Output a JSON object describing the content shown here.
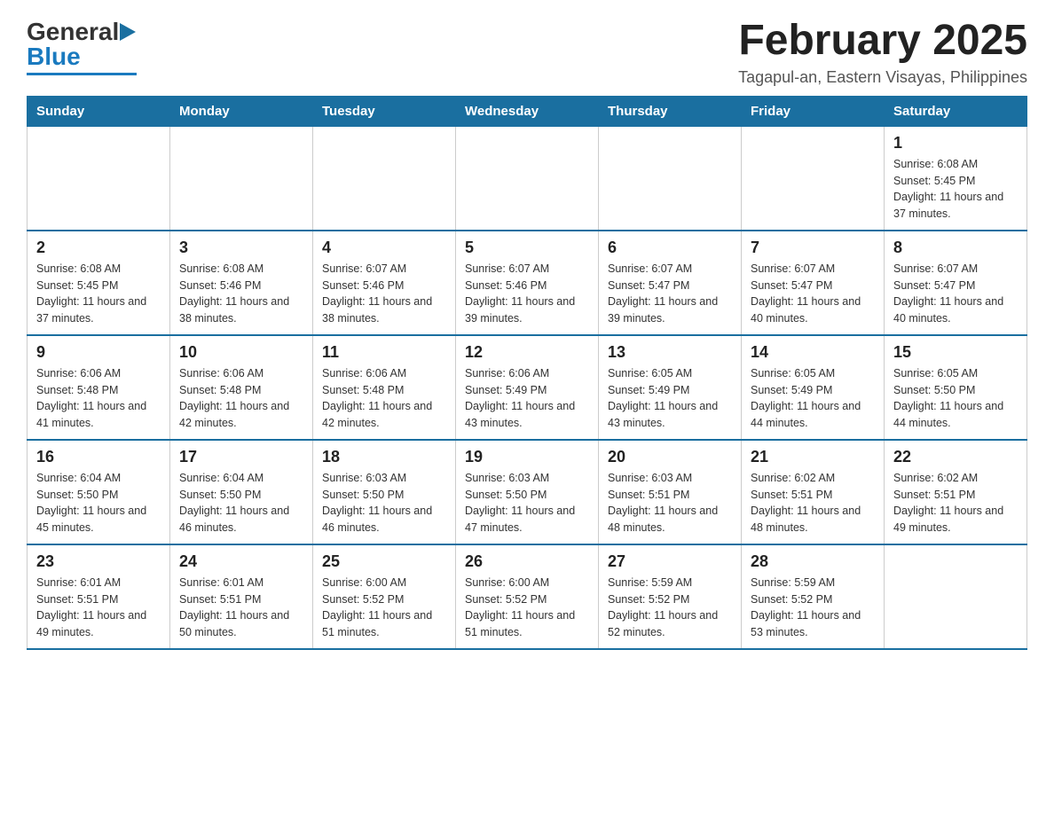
{
  "header": {
    "logo_general": "General",
    "logo_blue": "Blue",
    "month_title": "February 2025",
    "location": "Tagapul-an, Eastern Visayas, Philippines"
  },
  "days_of_week": [
    "Sunday",
    "Monday",
    "Tuesday",
    "Wednesday",
    "Thursday",
    "Friday",
    "Saturday"
  ],
  "weeks": [
    [
      {
        "day": "",
        "info": ""
      },
      {
        "day": "",
        "info": ""
      },
      {
        "day": "",
        "info": ""
      },
      {
        "day": "",
        "info": ""
      },
      {
        "day": "",
        "info": ""
      },
      {
        "day": "",
        "info": ""
      },
      {
        "day": "1",
        "info": "Sunrise: 6:08 AM\nSunset: 5:45 PM\nDaylight: 11 hours and 37 minutes."
      }
    ],
    [
      {
        "day": "2",
        "info": "Sunrise: 6:08 AM\nSunset: 5:45 PM\nDaylight: 11 hours and 37 minutes."
      },
      {
        "day": "3",
        "info": "Sunrise: 6:08 AM\nSunset: 5:46 PM\nDaylight: 11 hours and 38 minutes."
      },
      {
        "day": "4",
        "info": "Sunrise: 6:07 AM\nSunset: 5:46 PM\nDaylight: 11 hours and 38 minutes."
      },
      {
        "day": "5",
        "info": "Sunrise: 6:07 AM\nSunset: 5:46 PM\nDaylight: 11 hours and 39 minutes."
      },
      {
        "day": "6",
        "info": "Sunrise: 6:07 AM\nSunset: 5:47 PM\nDaylight: 11 hours and 39 minutes."
      },
      {
        "day": "7",
        "info": "Sunrise: 6:07 AM\nSunset: 5:47 PM\nDaylight: 11 hours and 40 minutes."
      },
      {
        "day": "8",
        "info": "Sunrise: 6:07 AM\nSunset: 5:47 PM\nDaylight: 11 hours and 40 minutes."
      }
    ],
    [
      {
        "day": "9",
        "info": "Sunrise: 6:06 AM\nSunset: 5:48 PM\nDaylight: 11 hours and 41 minutes."
      },
      {
        "day": "10",
        "info": "Sunrise: 6:06 AM\nSunset: 5:48 PM\nDaylight: 11 hours and 42 minutes."
      },
      {
        "day": "11",
        "info": "Sunrise: 6:06 AM\nSunset: 5:48 PM\nDaylight: 11 hours and 42 minutes."
      },
      {
        "day": "12",
        "info": "Sunrise: 6:06 AM\nSunset: 5:49 PM\nDaylight: 11 hours and 43 minutes."
      },
      {
        "day": "13",
        "info": "Sunrise: 6:05 AM\nSunset: 5:49 PM\nDaylight: 11 hours and 43 minutes."
      },
      {
        "day": "14",
        "info": "Sunrise: 6:05 AM\nSunset: 5:49 PM\nDaylight: 11 hours and 44 minutes."
      },
      {
        "day": "15",
        "info": "Sunrise: 6:05 AM\nSunset: 5:50 PM\nDaylight: 11 hours and 44 minutes."
      }
    ],
    [
      {
        "day": "16",
        "info": "Sunrise: 6:04 AM\nSunset: 5:50 PM\nDaylight: 11 hours and 45 minutes."
      },
      {
        "day": "17",
        "info": "Sunrise: 6:04 AM\nSunset: 5:50 PM\nDaylight: 11 hours and 46 minutes."
      },
      {
        "day": "18",
        "info": "Sunrise: 6:03 AM\nSunset: 5:50 PM\nDaylight: 11 hours and 46 minutes."
      },
      {
        "day": "19",
        "info": "Sunrise: 6:03 AM\nSunset: 5:50 PM\nDaylight: 11 hours and 47 minutes."
      },
      {
        "day": "20",
        "info": "Sunrise: 6:03 AM\nSunset: 5:51 PM\nDaylight: 11 hours and 48 minutes."
      },
      {
        "day": "21",
        "info": "Sunrise: 6:02 AM\nSunset: 5:51 PM\nDaylight: 11 hours and 48 minutes."
      },
      {
        "day": "22",
        "info": "Sunrise: 6:02 AM\nSunset: 5:51 PM\nDaylight: 11 hours and 49 minutes."
      }
    ],
    [
      {
        "day": "23",
        "info": "Sunrise: 6:01 AM\nSunset: 5:51 PM\nDaylight: 11 hours and 49 minutes."
      },
      {
        "day": "24",
        "info": "Sunrise: 6:01 AM\nSunset: 5:51 PM\nDaylight: 11 hours and 50 minutes."
      },
      {
        "day": "25",
        "info": "Sunrise: 6:00 AM\nSunset: 5:52 PM\nDaylight: 11 hours and 51 minutes."
      },
      {
        "day": "26",
        "info": "Sunrise: 6:00 AM\nSunset: 5:52 PM\nDaylight: 11 hours and 51 minutes."
      },
      {
        "day": "27",
        "info": "Sunrise: 5:59 AM\nSunset: 5:52 PM\nDaylight: 11 hours and 52 minutes."
      },
      {
        "day": "28",
        "info": "Sunrise: 5:59 AM\nSunset: 5:52 PM\nDaylight: 11 hours and 53 minutes."
      },
      {
        "day": "",
        "info": ""
      }
    ]
  ],
  "colors": {
    "header_bg": "#1a6fa0",
    "header_text": "#ffffff",
    "border": "#1a6fa0",
    "day_number": "#222222",
    "day_info": "#333333"
  }
}
